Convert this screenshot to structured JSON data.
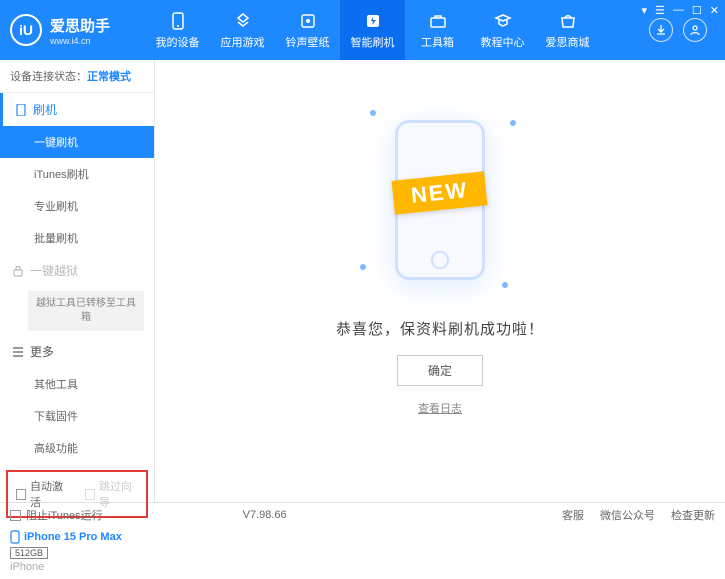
{
  "brand": {
    "name": "爱思助手",
    "url": "www.i4.cn",
    "logo_letter": "iU"
  },
  "topnav": [
    {
      "label": "我的设备",
      "icon": "device"
    },
    {
      "label": "应用游戏",
      "icon": "apps"
    },
    {
      "label": "铃声壁纸",
      "icon": "ringtone"
    },
    {
      "label": "智能刷机",
      "icon": "flash",
      "active": true
    },
    {
      "label": "工具箱",
      "icon": "toolbox"
    },
    {
      "label": "教程中心",
      "icon": "tutorial"
    },
    {
      "label": "爱思商城",
      "icon": "store"
    }
  ],
  "connection": {
    "label": "设备连接状态：",
    "value": "正常模式"
  },
  "sidebar": {
    "group_flash": "刷机",
    "items_flash": [
      "一键刷机",
      "iTunes刷机",
      "专业刷机",
      "批量刷机"
    ],
    "group_jailbreak": "一键越狱",
    "jailbreak_note": "越狱工具已转移至工具箱",
    "group_more": "更多",
    "items_more": [
      "其他工具",
      "下载固件",
      "高级功能"
    ]
  },
  "checkboxes": {
    "auto_activate": "自动激活",
    "skip_setup": "跳过向导"
  },
  "device": {
    "name": "iPhone 15 Pro Max",
    "storage": "512GB",
    "type": "iPhone"
  },
  "main": {
    "ribbon": "NEW",
    "message": "恭喜您，保资料刷机成功啦！",
    "ok": "确定",
    "log": "查看日志"
  },
  "statusbar": {
    "block_itunes": "阻止iTunes运行",
    "version": "V7.98.66",
    "links": [
      "客服",
      "微信公众号",
      "检查更新"
    ]
  },
  "window_controls": [
    "▾",
    "☰",
    "—",
    "☐",
    "✕"
  ]
}
